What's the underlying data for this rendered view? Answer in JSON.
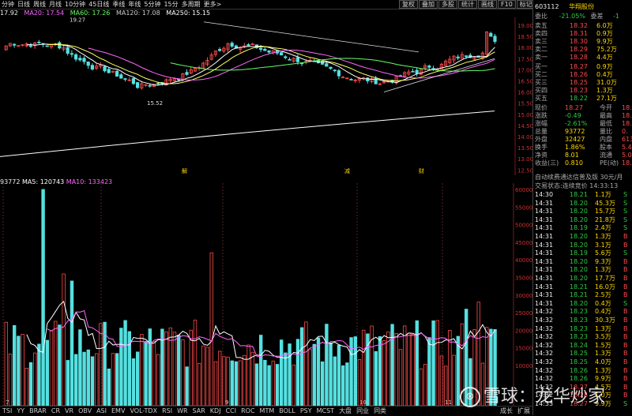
{
  "topbar": {
    "periods": [
      "分钟",
      "日线",
      "周线",
      "月线",
      "10分钟",
      "45日线",
      "季线",
      "年线",
      "5分钟",
      "15分",
      "多周期",
      "更多>"
    ],
    "tools": [
      "复权",
      "叠加",
      "多股",
      "统计",
      "画线",
      "F10",
      "标记",
      "+自选",
      "返回"
    ]
  },
  "ma_legend": {
    "ma10": "17.92",
    "ma20": "MA20: 17.54",
    "ma60": "MA60: 17.26",
    "ma120": "MA120: 17.08",
    "ma250": "MA250: 15.15"
  },
  "price_axis": [
    "19.00",
    "18.50",
    "18.00",
    "17.50",
    "17.00",
    "16.50",
    "16.00",
    "15.50",
    "15.00",
    "14.50",
    "14.00",
    "13.50",
    "13.00",
    "12.50"
  ],
  "annotations": {
    "high": "19.27",
    "low": "15.52",
    "mark1": "解",
    "mark2": "减",
    "mark3": "财"
  },
  "vol_legend": {
    "vol": "93772",
    "ma5": "MA5: 120743",
    "ma10": "MA10: 133423"
  },
  "vol_axis": [
    "60000",
    "55000",
    "50000",
    "45000",
    "40000",
    "35000",
    "30000",
    "25000",
    "20000",
    "15000",
    "10000"
  ],
  "date_axis": [
    "7",
    "8",
    "9",
    "10",
    "11"
  ],
  "bottom_tabs": [
    "TSI",
    "YY",
    "BRAR",
    "CR",
    "VR",
    "OBV",
    "ASI",
    "EMV",
    "VOL-TDX",
    "RSI",
    "WR",
    "SAR",
    "KDJ",
    "CCI",
    "ROC",
    "MTM",
    "BOLL",
    "PSY",
    "MCST",
    "大盘",
    "同业",
    "同类"
  ],
  "bottom_right": [
    "扩展",
    "成长"
  ],
  "stock": {
    "code": "603112",
    "name": "华翔股份"
  },
  "ratio": {
    "label": "委比",
    "value": "-21.05%",
    "label2": "委差",
    "value2": "-1"
  },
  "asks": [
    {
      "label": "卖五",
      "price": "18.32",
      "vol": "6.0万"
    },
    {
      "label": "卖四",
      "price": "18.31",
      "vol": "0.9万"
    },
    {
      "label": "卖三",
      "price": "18.30",
      "vol": "9.9万"
    },
    {
      "label": "卖二",
      "price": "18.29",
      "vol": "75.2万"
    },
    {
      "label": "卖一",
      "price": "18.28",
      "vol": "4.4万"
    }
  ],
  "bids": [
    {
      "label": "买一",
      "price": "18.27",
      "vol": "0.9万"
    },
    {
      "label": "买二",
      "price": "18.26",
      "vol": "0.4万"
    },
    {
      "label": "买三",
      "price": "18.25",
      "vol": "31.0万"
    },
    {
      "label": "买四",
      "price": "18.23",
      "vol": "1.3万"
    },
    {
      "label": "买五",
      "price": "18.22",
      "vol": "27.1万"
    }
  ],
  "quote": [
    {
      "l": "现价",
      "v": "18.27",
      "l2": "今开",
      "v2": "18."
    },
    {
      "l": "涨跌",
      "v": "-0.49",
      "l2": "最高",
      "v2": "18."
    },
    {
      "l": "涨幅",
      "v": "-2.61%",
      "l2": "最低",
      "v2": "18."
    },
    {
      "l": "总量",
      "v": "93772",
      "l2": "量比",
      "v2": "0."
    },
    {
      "l": "外盘",
      "v": "32427",
      "l2": "内盘",
      "v2": "613"
    },
    {
      "l": "换手",
      "v": "1.86%",
      "l2": "股本",
      "v2": "5.40"
    },
    {
      "l": "净资",
      "v": "8.01",
      "l2": "流通",
      "v2": "5.05"
    },
    {
      "l": "收益(三)",
      "v": "0.810",
      "l2": "PE(动)",
      "v2": "18."
    }
  ],
  "promo": "自动续费通达信普及版 30元/月",
  "trade_status": "交易状态:连续竞价 14:33:13",
  "ticks": [
    {
      "t": "14:30",
      "p": "18.21",
      "v": "1.1万",
      "s": "S"
    },
    {
      "t": "14:31",
      "p": "18.20",
      "v": "45.3万",
      "s": "S"
    },
    {
      "t": "14:31",
      "p": "18.20",
      "v": "15.7万",
      "s": "S"
    },
    {
      "t": "14:31",
      "p": "18.20",
      "v": "21.8万",
      "s": "S"
    },
    {
      "t": "14:31",
      "p": "18.19",
      "v": "2.4万",
      "s": "S"
    },
    {
      "t": "14:31",
      "p": "18.20",
      "v": "1.3万",
      "s": "B"
    },
    {
      "t": "14:31",
      "p": "18.20",
      "v": "3.1万",
      "s": "B"
    },
    {
      "t": "14:31",
      "p": "18.19",
      "v": "5.6万",
      "s": "S"
    },
    {
      "t": "14:31",
      "p": "18.20",
      "v": "9.3万",
      "s": "B"
    },
    {
      "t": "14:31",
      "p": "18.20",
      "v": "1.3万",
      "s": "B"
    },
    {
      "t": "14:31",
      "p": "18.20",
      "v": "17.7万",
      "s": "B"
    },
    {
      "t": "14:31",
      "p": "18.21",
      "v": "16.0万",
      "s": "B"
    },
    {
      "t": "14:31",
      "p": "18.21",
      "v": "2.5万",
      "s": "B"
    },
    {
      "t": "14:31",
      "p": "18.20",
      "v": "0.4万",
      "s": "S"
    },
    {
      "t": "14:32",
      "p": "18.23",
      "v": "0.4万",
      "s": "B"
    },
    {
      "t": "14:32",
      "p": "18.23",
      "v": "30.3万",
      "s": "B"
    },
    {
      "t": "14:32",
      "p": "18.23",
      "v": "1.3万",
      "s": "B"
    },
    {
      "t": "14:32",
      "p": "18.23",
      "v": "3.5万",
      "s": "B"
    },
    {
      "t": "14:32",
      "p": "18.24",
      "v": "1.5万",
      "s": "B"
    },
    {
      "t": "14:32",
      "p": "18.25",
      "v": "1.3万",
      "s": "B"
    },
    {
      "t": "14:32",
      "p": "18.25",
      "v": "4.0万",
      "s": "B"
    },
    {
      "t": "14:32",
      "p": "18.26",
      "v": "1.3万",
      "s": "B"
    },
    {
      "t": "14:32",
      "p": "18.26",
      "v": "9.9万",
      "s": "B"
    },
    {
      "t": "14:32",
      "p": "18.27",
      "v": "4.5万",
      "s": "B"
    },
    {
      "t": "14:32",
      "p": "18.28",
      "v": "1.0万",
      "s": "B"
    },
    {
      "t": "14:33",
      "p": "18.27",
      "v": "9.9万",
      "s": "S"
    }
  ],
  "watermark": "雪球：龙华炒家",
  "colors": {
    "up": "#ff4a4a",
    "down": "#55e0e0",
    "bg": "#000000"
  }
}
